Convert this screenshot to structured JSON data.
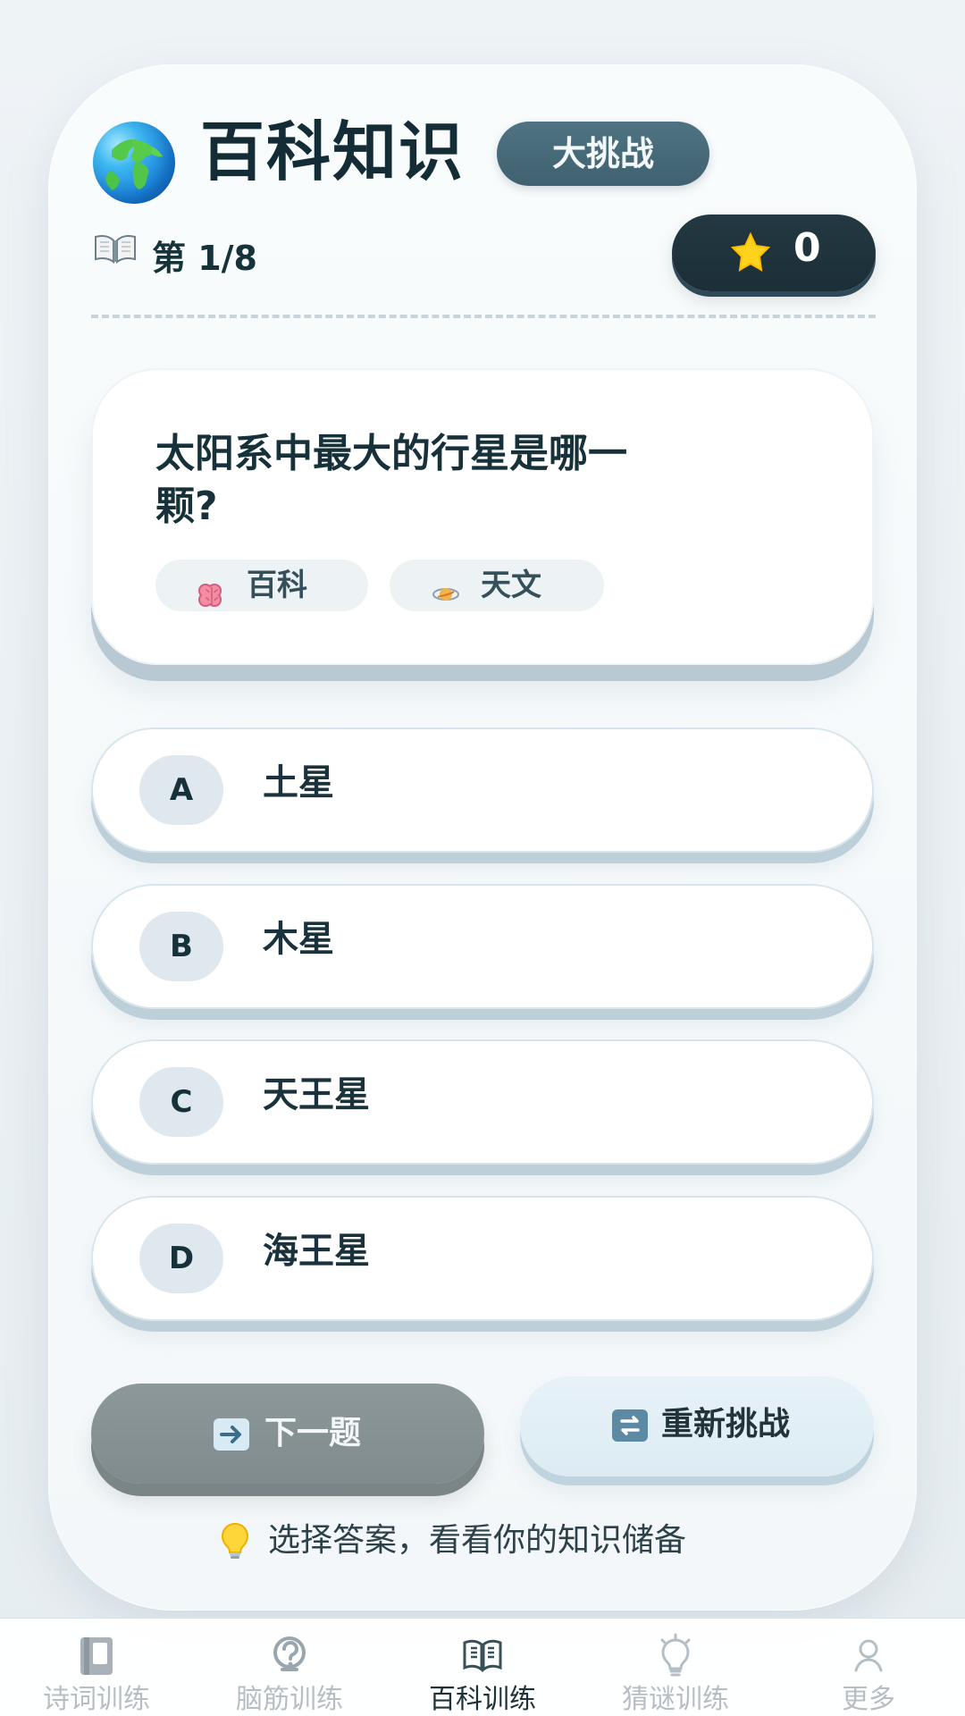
{
  "header": {
    "title": "百科知识",
    "badge": "大挑战"
  },
  "progress": {
    "text": "第 1/8",
    "score": "0"
  },
  "question": {
    "text": "太阳系中最大的行星是哪一\n颗?",
    "tags": [
      {
        "label": "百科",
        "icon": "brain-icon"
      },
      {
        "label": "天文",
        "icon": "planet-icon"
      }
    ]
  },
  "options": [
    {
      "letter": "A",
      "text": "土星"
    },
    {
      "letter": "B",
      "text": "木星"
    },
    {
      "letter": "C",
      "text": "天王星"
    },
    {
      "letter": "D",
      "text": "海王星"
    }
  ],
  "actions": {
    "next": "下一题",
    "restart": "重新挑战"
  },
  "hint": "选择答案，看看你的知识储备",
  "bottom_nav": {
    "items": [
      {
        "label": "诗词训练",
        "icon": "book-nav-icon"
      },
      {
        "label": "脑筋训练",
        "icon": "question-nav-icon"
      },
      {
        "label": "百科训练",
        "icon": "encyclopedia-nav-icon"
      },
      {
        "label": "猜谜训练",
        "icon": "lightbulb-nav-icon"
      },
      {
        "label": "更多",
        "icon": "profile-nav-icon"
      }
    ]
  },
  "colors": {
    "background": "#eef3f6",
    "card": "#f8fbfc",
    "dark_badge": "#233842",
    "accent_badge": "#4f7382",
    "next_button": "#8c9899",
    "restart_button": "#e3eff5",
    "active_nav": "#203239",
    "inactive_nav": "#b7bec3"
  }
}
